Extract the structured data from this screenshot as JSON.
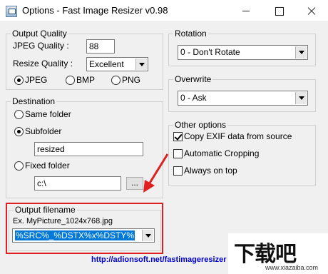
{
  "window": {
    "title": "Options - Fast Image Resizer v0.98",
    "icon": "app-icon"
  },
  "output_quality": {
    "legend": "Output Quality",
    "jpeg_quality_label": "JPEG Quality :",
    "jpeg_quality_value": "88",
    "resize_quality_label": "Resize Quality :",
    "resize_quality_value": "Excellent",
    "formats": [
      "JPEG",
      "BMP",
      "PNG"
    ],
    "selected_format": "JPEG"
  },
  "destination": {
    "legend": "Destination",
    "same_folder_label": "Same folder",
    "subfolder_label": "Subfolder",
    "subfolder_value": "resized",
    "fixed_folder_label": "Fixed folder",
    "fixed_folder_value": "c:\\",
    "browse_label": "...",
    "selected": "Subfolder"
  },
  "output_filename": {
    "legend": "Output filename",
    "example": "Ex. MyPicture_1024x768.jpg",
    "pattern_value": "%SRC%_%DSTX%x%DSTY%"
  },
  "rotation": {
    "legend": "Rotation",
    "value": "0 - Don't Rotate"
  },
  "overwrite": {
    "legend": "Overwrite",
    "value": "0 - Ask"
  },
  "other_options": {
    "legend": "Other options",
    "copy_exif_label": "Copy EXIF data from source",
    "copy_exif_checked": true,
    "auto_crop_label": "Automatic Cropping",
    "auto_crop_checked": false,
    "always_on_top_label": "Always on top",
    "always_on_top_checked": false
  },
  "footer": {
    "link": "http://adionsoft.net/fastimageresizer"
  },
  "watermark": {
    "big": "下载吧",
    "small": "www.xiazaiba.com"
  },
  "colors": {
    "annotation": "#e02020",
    "link": "#0000cc",
    "selection": "#0078d7"
  }
}
